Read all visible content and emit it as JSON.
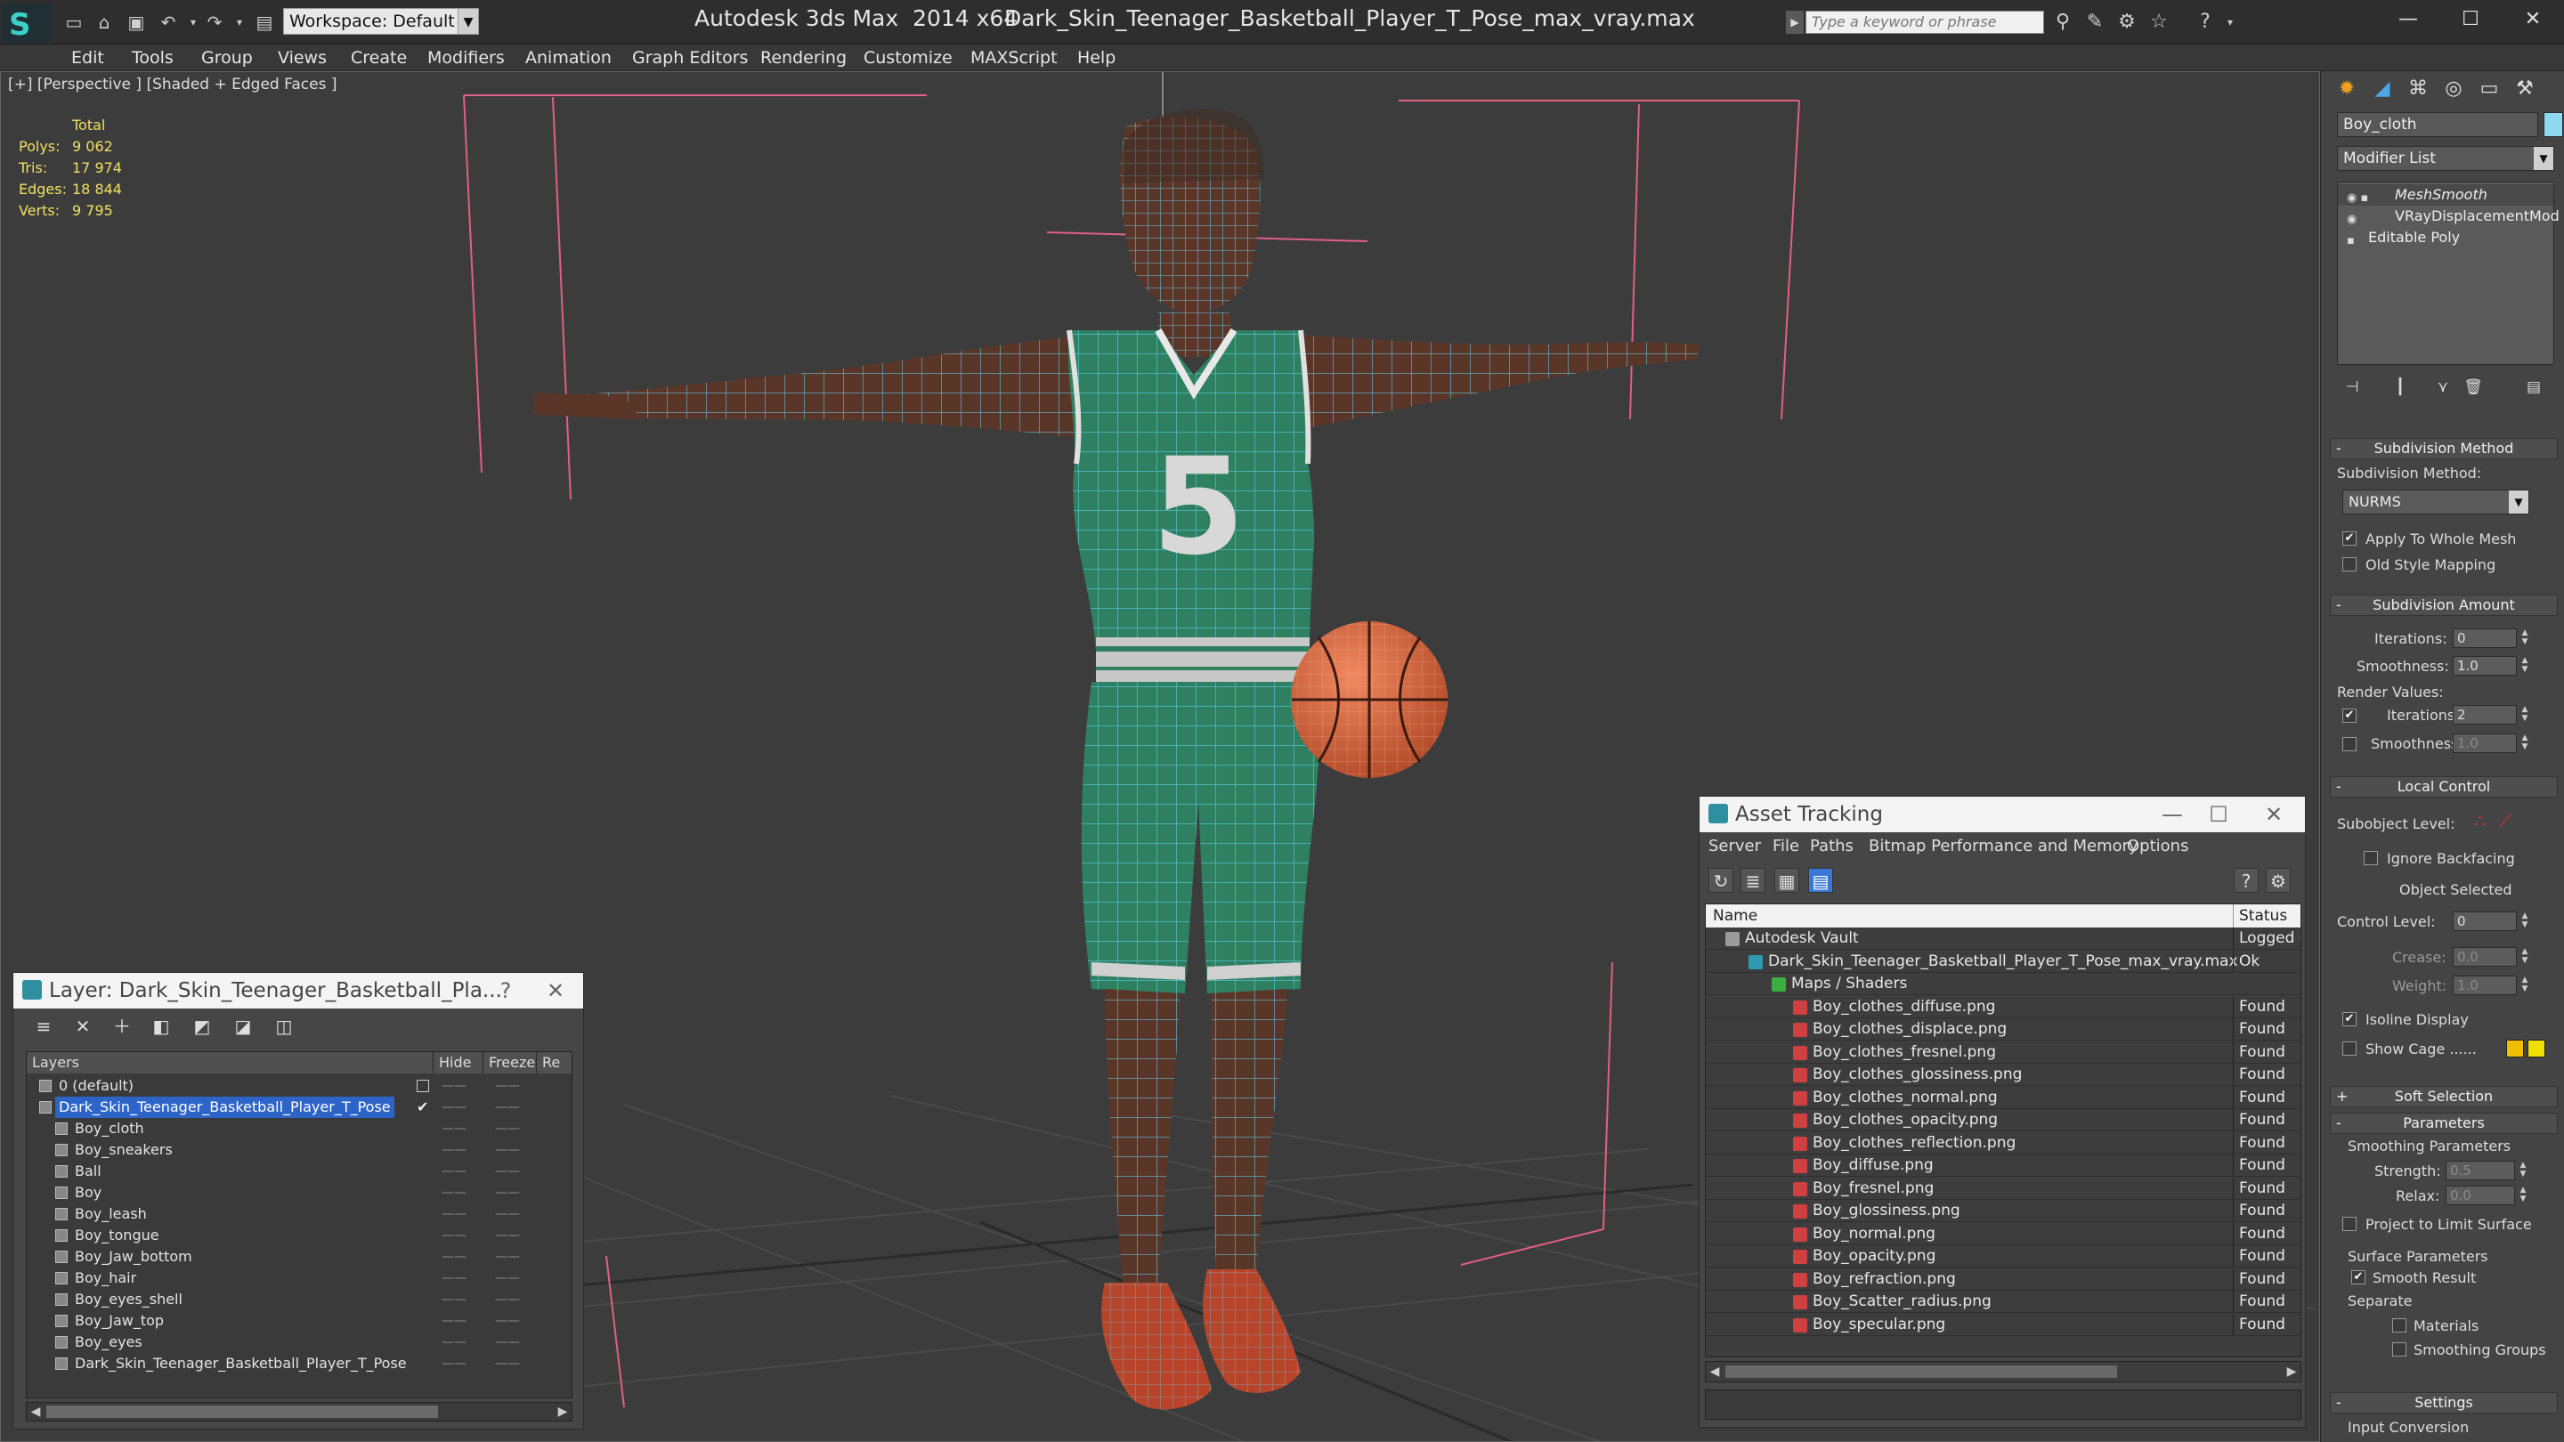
{
  "titlebar": {
    "app_title": "Autodesk 3ds Max  2014 x64",
    "file_title": "Dark_Skin_Teenager_Basketball_Player_T_Pose_max_vray.max",
    "workspace": "Workspace: Default",
    "search_placeholder": "Type a keyword or phrase"
  },
  "menu": [
    "Edit",
    "Tools",
    "Group",
    "Views",
    "Create",
    "Modifiers",
    "Animation",
    "Graph Editors",
    "Rendering",
    "Customize",
    "MAXScript",
    "Help"
  ],
  "viewport": {
    "label": "[+] [Perspective ] [Shaded + Edged Faces ]",
    "stats_header": "Total",
    "stats": [
      {
        "label": "Polys:",
        "value": "9 062"
      },
      {
        "label": "Tris:",
        "value": "17 974"
      },
      {
        "label": "Edges:",
        "value": "18 844"
      },
      {
        "label": "Verts:",
        "value": "9 795"
      }
    ],
    "jersey_number": "5"
  },
  "layer_window": {
    "title": "Layer: Dark_Skin_Teenager_Basketball_Pla...",
    "help": "?",
    "close": "✕",
    "columns": {
      "layers": "Layers",
      "hide": "Hide",
      "freeze": "Freeze",
      "render": "Re"
    },
    "rows": [
      {
        "name": "0 (default)",
        "indent": 0,
        "selected": false
      },
      {
        "name": "Dark_Skin_Teenager_Basketball_Player_T_Pose",
        "indent": 0,
        "selected": true
      },
      {
        "name": "Boy_cloth",
        "indent": 1,
        "selected": false
      },
      {
        "name": "Boy_sneakers",
        "indent": 1,
        "selected": false
      },
      {
        "name": "Ball",
        "indent": 1,
        "selected": false
      },
      {
        "name": "Boy",
        "indent": 1,
        "selected": false
      },
      {
        "name": "Boy_leash",
        "indent": 1,
        "selected": false
      },
      {
        "name": "Boy_tongue",
        "indent": 1,
        "selected": false
      },
      {
        "name": "Boy_Jaw_bottom",
        "indent": 1,
        "selected": false
      },
      {
        "name": "Boy_hair",
        "indent": 1,
        "selected": false
      },
      {
        "name": "Boy_eyes_shell",
        "indent": 1,
        "selected": false
      },
      {
        "name": "Boy_Jaw_top",
        "indent": 1,
        "selected": false
      },
      {
        "name": "Boy_eyes",
        "indent": 1,
        "selected": false
      },
      {
        "name": "Dark_Skin_Teenager_Basketball_Player_T_Pose",
        "indent": 1,
        "selected": false
      }
    ]
  },
  "asset_window": {
    "title": "Asset Tracking",
    "menu": [
      "Server",
      "File",
      "Paths",
      "Bitmap Performance and Memory",
      "Options"
    ],
    "columns": {
      "name": "Name",
      "status": "Status"
    },
    "rows": [
      {
        "name": "Autodesk Vault",
        "status": "Logged O",
        "level": 0,
        "icon": "vault"
      },
      {
        "name": "Dark_Skin_Teenager_Basketball_Player_T_Pose_max_vray.max",
        "status": "Ok",
        "level": 1,
        "icon": "max"
      },
      {
        "name": "Maps / Shaders",
        "status": "",
        "level": 2,
        "icon": "folder"
      },
      {
        "name": "Boy_clothes_diffuse.png",
        "status": "Found",
        "level": 3,
        "icon": "png"
      },
      {
        "name": "Boy_clothes_displace.png",
        "status": "Found",
        "level": 3,
        "icon": "png"
      },
      {
        "name": "Boy_clothes_fresnel.png",
        "status": "Found",
        "level": 3,
        "icon": "png"
      },
      {
        "name": "Boy_clothes_glossiness.png",
        "status": "Found",
        "level": 3,
        "icon": "png"
      },
      {
        "name": "Boy_clothes_normal.png",
        "status": "Found",
        "level": 3,
        "icon": "png"
      },
      {
        "name": "Boy_clothes_opacity.png",
        "status": "Found",
        "level": 3,
        "icon": "png"
      },
      {
        "name": "Boy_clothes_reflection.png",
        "status": "Found",
        "level": 3,
        "icon": "png"
      },
      {
        "name": "Boy_diffuse.png",
        "status": "Found",
        "level": 3,
        "icon": "png"
      },
      {
        "name": "Boy_fresnel.png",
        "status": "Found",
        "level": 3,
        "icon": "png"
      },
      {
        "name": "Boy_glossiness.png",
        "status": "Found",
        "level": 3,
        "icon": "png"
      },
      {
        "name": "Boy_normal.png",
        "status": "Found",
        "level": 3,
        "icon": "png"
      },
      {
        "name": "Boy_opacity.png",
        "status": "Found",
        "level": 3,
        "icon": "png"
      },
      {
        "name": "Boy_refraction.png",
        "status": "Found",
        "level": 3,
        "icon": "png"
      },
      {
        "name": "Boy_Scatter_radius.png",
        "status": "Found",
        "level": 3,
        "icon": "png"
      },
      {
        "name": "Boy_specular.png",
        "status": "Found",
        "level": 3,
        "icon": "png"
      }
    ]
  },
  "command_panel": {
    "object_name": "Boy_cloth",
    "modifier_list": "Modifier List",
    "stack": [
      "MeshSmooth",
      "VRayDisplacementMod",
      "Editable Poly"
    ],
    "subdivision_method": {
      "header": "Subdivision Method",
      "label": "Subdivision Method:",
      "value": "NURMS",
      "apply_whole_mesh": "Apply To Whole Mesh",
      "old_style": "Old Style Mapping"
    },
    "subdivision_amount": {
      "header": "Subdivision Amount",
      "iterations_label": "Iterations:",
      "iterations": "0",
      "smoothness_label": "Smoothness:",
      "smoothness": "1.0",
      "render_values": "Render Values:",
      "r_iterations": "2",
      "r_smoothness": "1.0"
    },
    "local_control": {
      "header": "Local Control",
      "subobject_level": "Subobject Level:",
      "ignore_backfacing": "Ignore Backfacing",
      "object_selected": "Object Selected",
      "control_level_label": "Control Level:",
      "control_level": "0",
      "crease_label": "Crease:",
      "crease": "0.0",
      "weight_label": "Weight:",
      "weight": "1.0",
      "isoline_display": "Isoline Display",
      "show_cage": "Show Cage ......"
    },
    "soft_selection": {
      "header": "Soft Selection"
    },
    "parameters": {
      "header": "Parameters",
      "smoothing_params": "Smoothing Parameters",
      "strength_label": "Strength:",
      "strength": "0.5",
      "relax_label": "Relax:",
      "relax": "0.0",
      "project_limit": "Project to Limit Surface",
      "surface_params": "Surface Parameters",
      "smooth_result": "Smooth Result",
      "separate": "Separate",
      "materials": "Materials",
      "smoothing_groups": "Smoothing Groups"
    },
    "settings": {
      "header": "Settings",
      "input_conversion": "Input Conversion"
    }
  },
  "colors": {
    "selection": "#2d64c8",
    "jersey": "#2e8060",
    "wire": "#54d8ff",
    "ball": "#e07040",
    "cage_yellow": "#f0c000"
  }
}
